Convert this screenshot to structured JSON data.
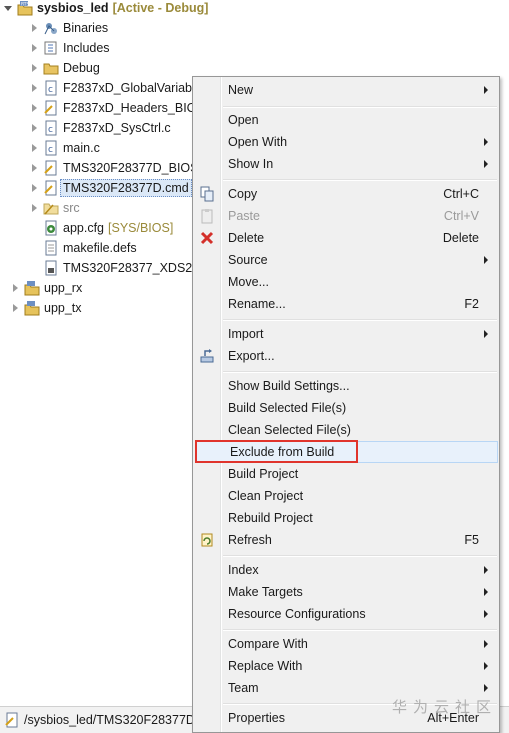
{
  "tree": {
    "project": {
      "name": "sysbios_led",
      "status": "[Active - Debug]"
    },
    "items": [
      {
        "label": "Binaries",
        "icon": "binaries-icon"
      },
      {
        "label": "Includes",
        "icon": "includes-icon"
      },
      {
        "label": "Debug",
        "icon": "folder-icon"
      },
      {
        "label": "F2837xD_GlobalVariab",
        "icon": "c-file-icon"
      },
      {
        "label": "F2837xD_Headers_BIC",
        "icon": "c-file-icon"
      },
      {
        "label": "F2837xD_SysCtrl.c",
        "icon": "c-file-icon"
      },
      {
        "label": "main.c",
        "icon": "c-file-icon"
      },
      {
        "label": "TMS320F28377D_BIOS",
        "icon": "cmd-file-icon"
      },
      {
        "label": "TMS320F28377D.cmd",
        "icon": "cmd-file-icon"
      },
      {
        "label": "src",
        "icon": "folder-icon"
      },
      {
        "label": "app.cfg",
        "deco": "[SYS/BIOS]",
        "icon": "cfg-file-icon"
      },
      {
        "label": "makefile.defs",
        "icon": "file-icon"
      },
      {
        "label": "TMS320F28377_XDS20",
        "icon": "ccxml-file-icon"
      }
    ],
    "projects": [
      {
        "label": "upp_rx"
      },
      {
        "label": "upp_tx"
      }
    ]
  },
  "status_bar": {
    "path": "/sysbios_led/TMS320F28377D"
  },
  "watermark": "华为云社区",
  "menu": {
    "items": [
      {
        "label": "New",
        "submenu": true
      },
      {
        "label": "Open"
      },
      {
        "label": "Open With",
        "submenu": true
      },
      {
        "label": "Show In",
        "submenu": true
      },
      {
        "label": "Copy",
        "accel": "Ctrl+C",
        "icon": "copy-icon"
      },
      {
        "label": "Paste",
        "accel": "Ctrl+V",
        "disabled": true,
        "icon": "paste-icon"
      },
      {
        "label": "Delete",
        "accel": "Delete",
        "icon": "delete-icon"
      },
      {
        "label": "Source",
        "submenu": true
      },
      {
        "label": "Move..."
      },
      {
        "label": "Rename...",
        "accel": "F2"
      },
      {
        "label": "Import",
        "submenu": true
      },
      {
        "label": "Export...",
        "icon": "export-icon"
      },
      {
        "label": "Show Build Settings..."
      },
      {
        "label": "Build Selected File(s)"
      },
      {
        "label": "Clean Selected File(s)"
      },
      {
        "label": "Exclude from Build",
        "highlighted": true
      },
      {
        "label": "Build Project"
      },
      {
        "label": "Clean Project"
      },
      {
        "label": "Rebuild Project"
      },
      {
        "label": "Refresh",
        "accel": "F5",
        "icon": "refresh-icon"
      },
      {
        "label": "Index",
        "submenu": true
      },
      {
        "label": "Make Targets",
        "submenu": true
      },
      {
        "label": "Resource Configurations",
        "submenu": true
      },
      {
        "label": "Compare With",
        "submenu": true
      },
      {
        "label": "Replace With",
        "submenu": true
      },
      {
        "label": "Team",
        "submenu": true
      },
      {
        "label": "Properties",
        "accel": "Alt+Enter"
      }
    ]
  },
  "colors": {
    "highlight_box": "#e0342c",
    "selection": "#dbe8f7",
    "menu_bg": "#f0f0f0"
  }
}
